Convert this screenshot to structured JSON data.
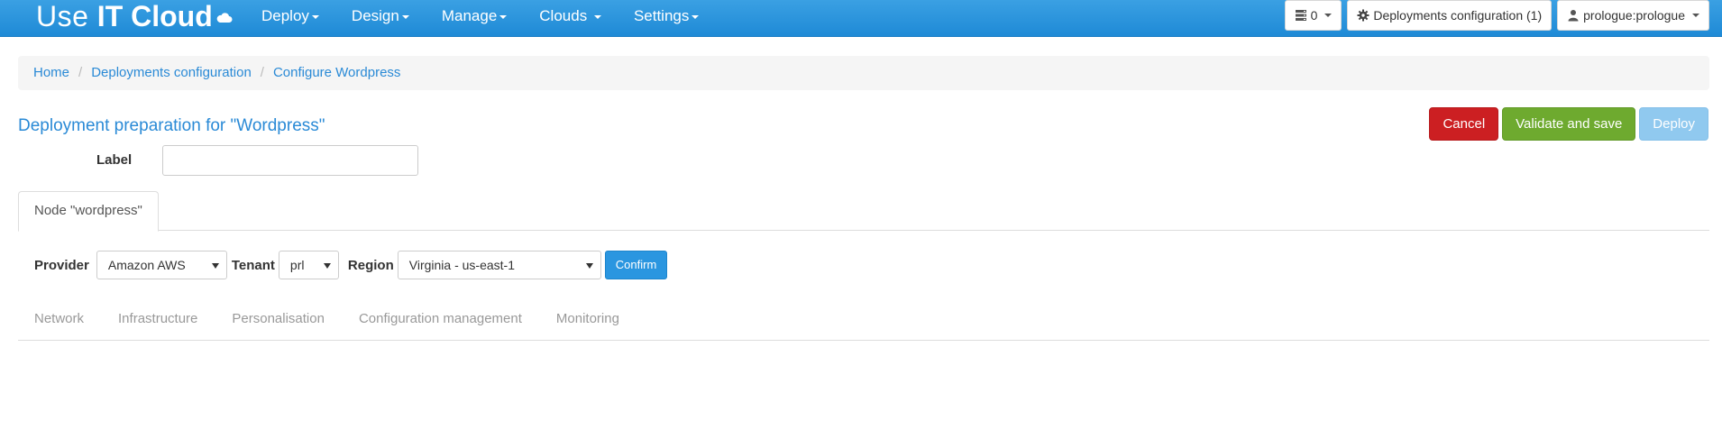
{
  "brand": {
    "part1": "Use ",
    "part2": "IT Cloud"
  },
  "nav": {
    "items": [
      {
        "label": "Deploy"
      },
      {
        "label": "Design"
      },
      {
        "label": "Manage"
      },
      {
        "label": "Clouds"
      },
      {
        "label": "Settings"
      }
    ],
    "right": {
      "tasks_count": "0",
      "deployments_config": "Deployments configuration (1)",
      "user": "prologue:prologue"
    }
  },
  "breadcrumb": {
    "home": "Home",
    "deployments": "Deployments configuration",
    "current": "Configure Wordpress",
    "separator": "/"
  },
  "page": {
    "title": "Deployment preparation for \"Wordpress\"",
    "label_field": {
      "label": "Label",
      "value": "",
      "placeholder": ""
    }
  },
  "actions": {
    "cancel": "Cancel",
    "validate_save": "Validate and save",
    "deploy": "Deploy"
  },
  "node_tab": {
    "label": "Node \"wordpress\""
  },
  "provider_row": {
    "provider_label": "Provider",
    "provider_value": "Amazon AWS",
    "tenant_label": "Tenant",
    "tenant_value": "prl",
    "region_label": "Region",
    "region_value": "Virginia - us-east-1",
    "confirm": "Confirm"
  },
  "section_tabs": [
    {
      "label": "Network"
    },
    {
      "label": "Infrastructure"
    },
    {
      "label": "Personalisation"
    },
    {
      "label": "Configuration management"
    },
    {
      "label": "Monitoring"
    }
  ],
  "colors": {
    "navbar": "#1f8ad6",
    "link": "#2a8ad6",
    "cancel": "#cc1f22",
    "save": "#6eaa2f",
    "deploy": "#90c9ef",
    "confirm": "#2a96e0"
  },
  "icons": {
    "brand": "cloud-icon",
    "tasks": "server-list-icon",
    "deployments": "gear-icon",
    "user": "user-icon"
  }
}
